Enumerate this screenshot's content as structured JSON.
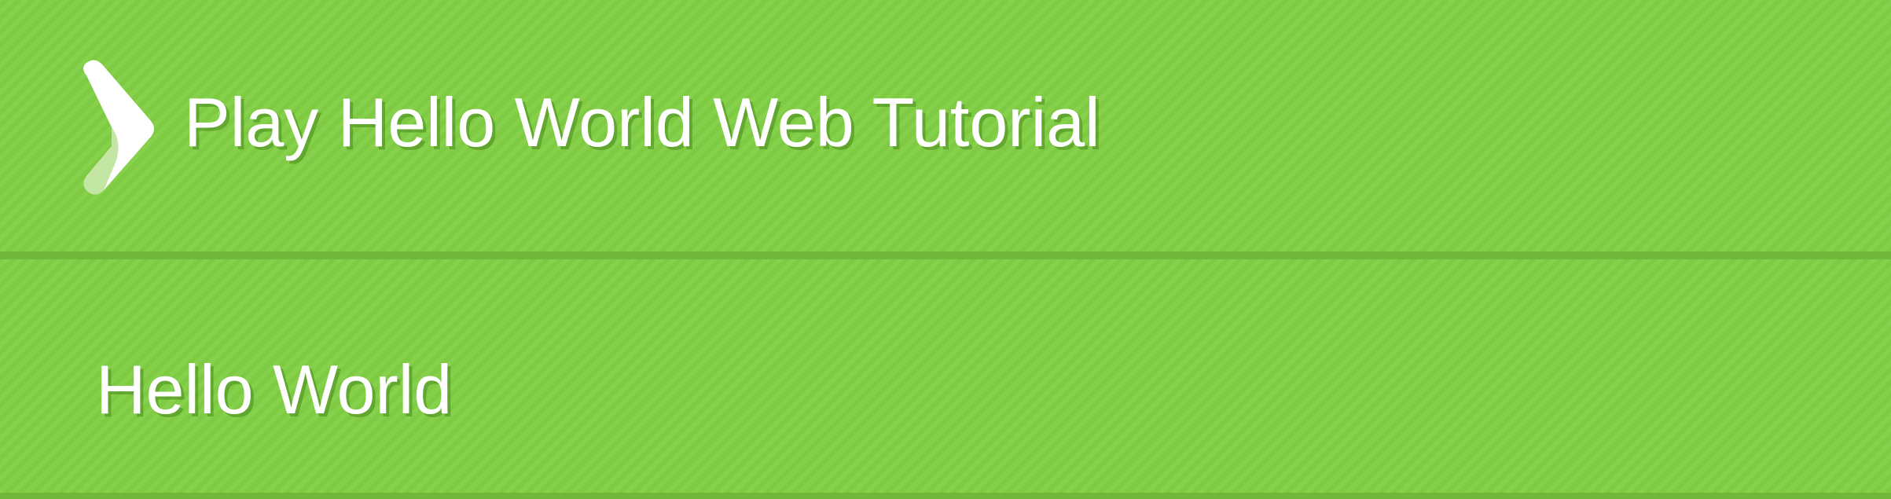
{
  "header": {
    "logo_icon": "play-chevron-icon",
    "title": "Play Hello World Web Tutorial"
  },
  "main": {
    "heading": "Hello World"
  },
  "colors": {
    "background": "#80cf44",
    "divider": "#6fb83a",
    "text": "#ffffff"
  }
}
